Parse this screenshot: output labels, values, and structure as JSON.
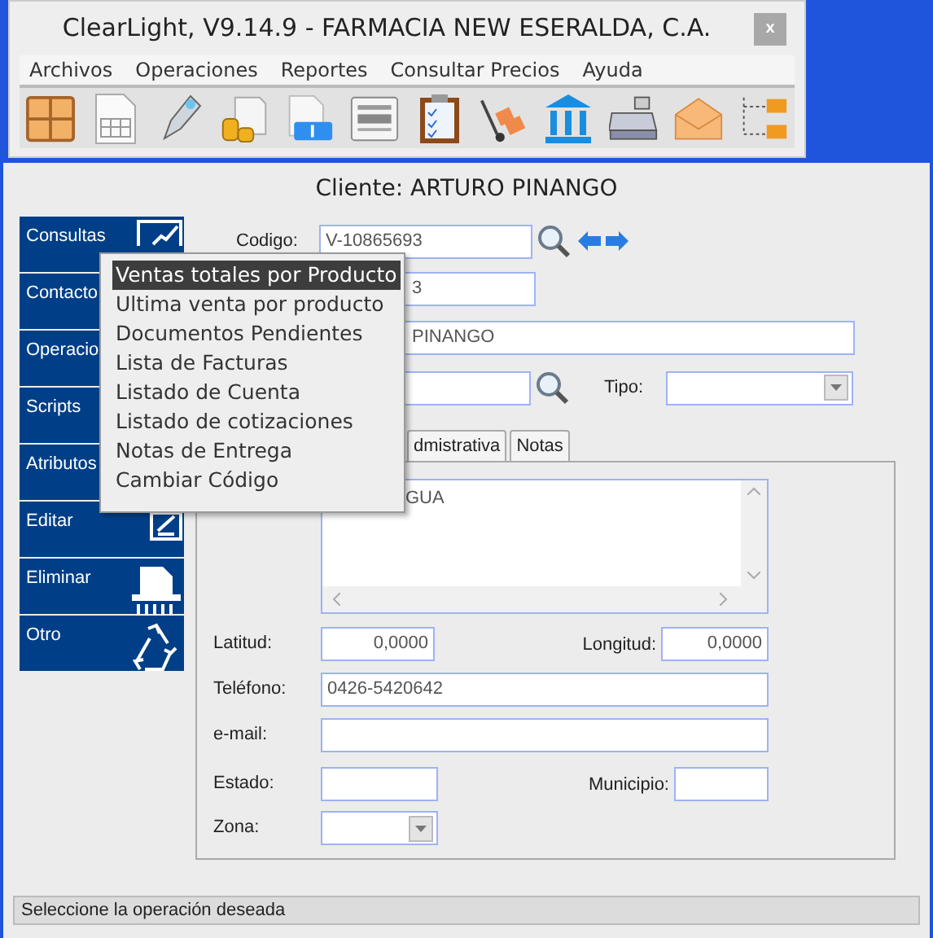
{
  "app_window": {
    "title": "ClearLight, V9.14.9 - FARMACIA NEW ESERALDA, C.A.",
    "close_label": "x"
  },
  "menu_bar": [
    "Archivos",
    "Operaciones",
    "Reportes",
    "Consultar Precios",
    "Ayuda"
  ],
  "client_window": {
    "title": "Cliente: ARTURO PINANGO"
  },
  "sidebar": [
    {
      "label": "Consultas"
    },
    {
      "label": "Contacto"
    },
    {
      "label": "Operacio"
    },
    {
      "label": "Scripts"
    },
    {
      "label": "Atributos"
    },
    {
      "label": "Editar"
    },
    {
      "label": "Eliminar"
    },
    {
      "label": "Otro"
    }
  ],
  "popup_menu": [
    {
      "label": "Ventas totales por Producto",
      "selected": true
    },
    {
      "label": "Ultima venta por producto",
      "selected": false
    },
    {
      "label": "Documentos Pendientes",
      "selected": false
    },
    {
      "label": "Lista de Facturas",
      "selected": false
    },
    {
      "label": "Listado de Cuenta",
      "selected": false
    },
    {
      "label": "Listado de cotizaciones",
      "selected": false
    },
    {
      "label": "Notas de Entrega",
      "selected": false
    },
    {
      "label": "Cambiar Código",
      "selected": false
    }
  ],
  "header": {
    "codigo_label": "Codigo:",
    "codigo": "V-10865693",
    "field_2": "3",
    "field_3": "PINANGO",
    "tipo_label": "Tipo:"
  },
  "tabs": [
    {
      "label": "dmistrativa",
      "selected": false
    },
    {
      "label": "Notas",
      "selected": false
    }
  ],
  "panel": {
    "memo": "GUA",
    "latitud_label": "Latitud:",
    "latitud": "0,0000",
    "longitud_label": "Longitud:",
    "longitud": "0,0000",
    "telefono_label": "Teléfono:",
    "telefono": "0426-5420642",
    "email_label": "e-mail:",
    "estado_label": "Estado:",
    "municipio_label": "Municipio:",
    "zona_label": "Zona:"
  },
  "status_bar": "Seleccione la operación deseada"
}
